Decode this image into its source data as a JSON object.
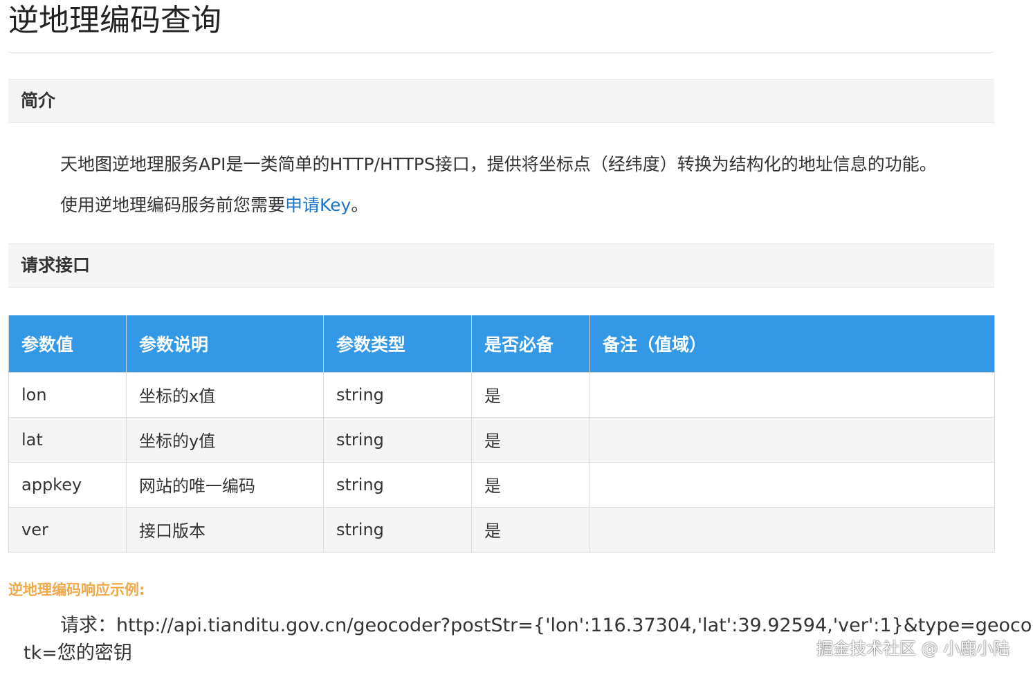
{
  "page": {
    "title": "逆地理编码查询"
  },
  "intro": {
    "heading": "简介",
    "line1": "天地图逆地理服务API是一类简单的HTTP/HTTPS接口，提供将坐标点（经纬度）转换为结构化的地址信息的功能。",
    "line2_prefix": "使用逆地理编码服务前您需要",
    "line2_link": "申请Key",
    "line2_suffix": "。"
  },
  "request": {
    "heading": "请求接口",
    "table": {
      "headers": [
        "参数值",
        "参数说明",
        "参数类型",
        "是否必备",
        "备注（值域）"
      ],
      "rows": [
        [
          "lon",
          "坐标的x值",
          "string",
          "是",
          ""
        ],
        [
          "lat",
          "坐标的y值",
          "string",
          "是",
          ""
        ],
        [
          "appkey",
          "网站的唯一编码",
          "string",
          "是",
          ""
        ],
        [
          "ver",
          "接口版本",
          "string",
          "是",
          ""
        ]
      ]
    }
  },
  "example": {
    "heading": "逆地理编码响应示例:",
    "request_line1": "请求：http://api.tianditu.gov.cn/geocoder?postStr={'lon':116.37304,'lat':39.92594,'ver':1}&type=geocode&",
    "request_line2": "tk=您的密钥"
  },
  "watermark": "掘金技术社区 @ 小鹿小陆",
  "colors": {
    "table_header_bg": "#3399e6",
    "link": "#1a73c8",
    "example_heading": "#f0a94a",
    "section_bar_bg": "#f5f5f5"
  }
}
